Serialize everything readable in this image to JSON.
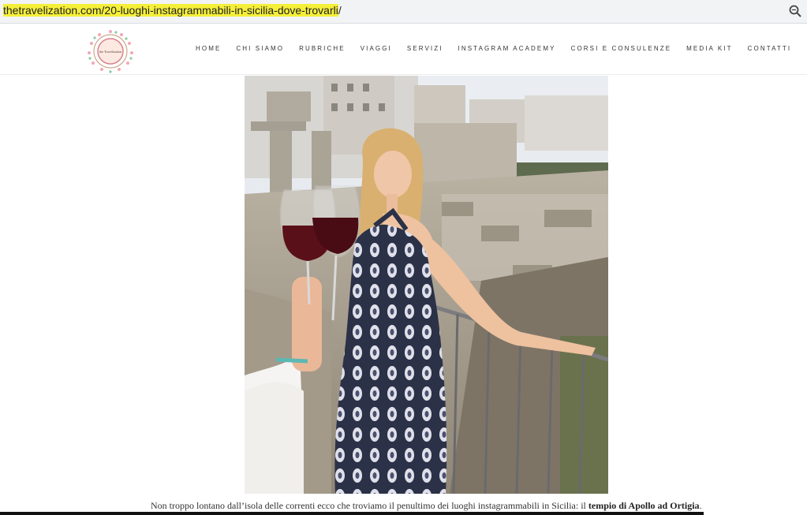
{
  "browser": {
    "url_domain": "thetravelization.com",
    "url_slash": "/",
    "url_path": "20-luoghi-instagrammabili-in-sicilia-dove-trovarli",
    "url_trailing": "/",
    "zoom_icon": "magnifier-icon"
  },
  "header": {
    "logo_text": "the Travelization",
    "nav": [
      "HOME",
      "CHI SIAMO",
      "RUBRICHE",
      "VIAGGI",
      "SERVIZI",
      "INSTAGRAM ACADEMY",
      "CORSI E CONSULENZE",
      "MEDIA KIT",
      "CONTATTI"
    ]
  },
  "article": {
    "caption_text": "Non troppo lontano dall’isola delle correnti ecco che troviamo il penultimo dei luoghi instagrammabili in Sicilia: il ",
    "caption_bold": "tempio di Apollo ad Ortigia",
    "caption_end": "."
  },
  "colors": {
    "highlight": "#f5ef3a",
    "dress": "#2b3147"
  }
}
